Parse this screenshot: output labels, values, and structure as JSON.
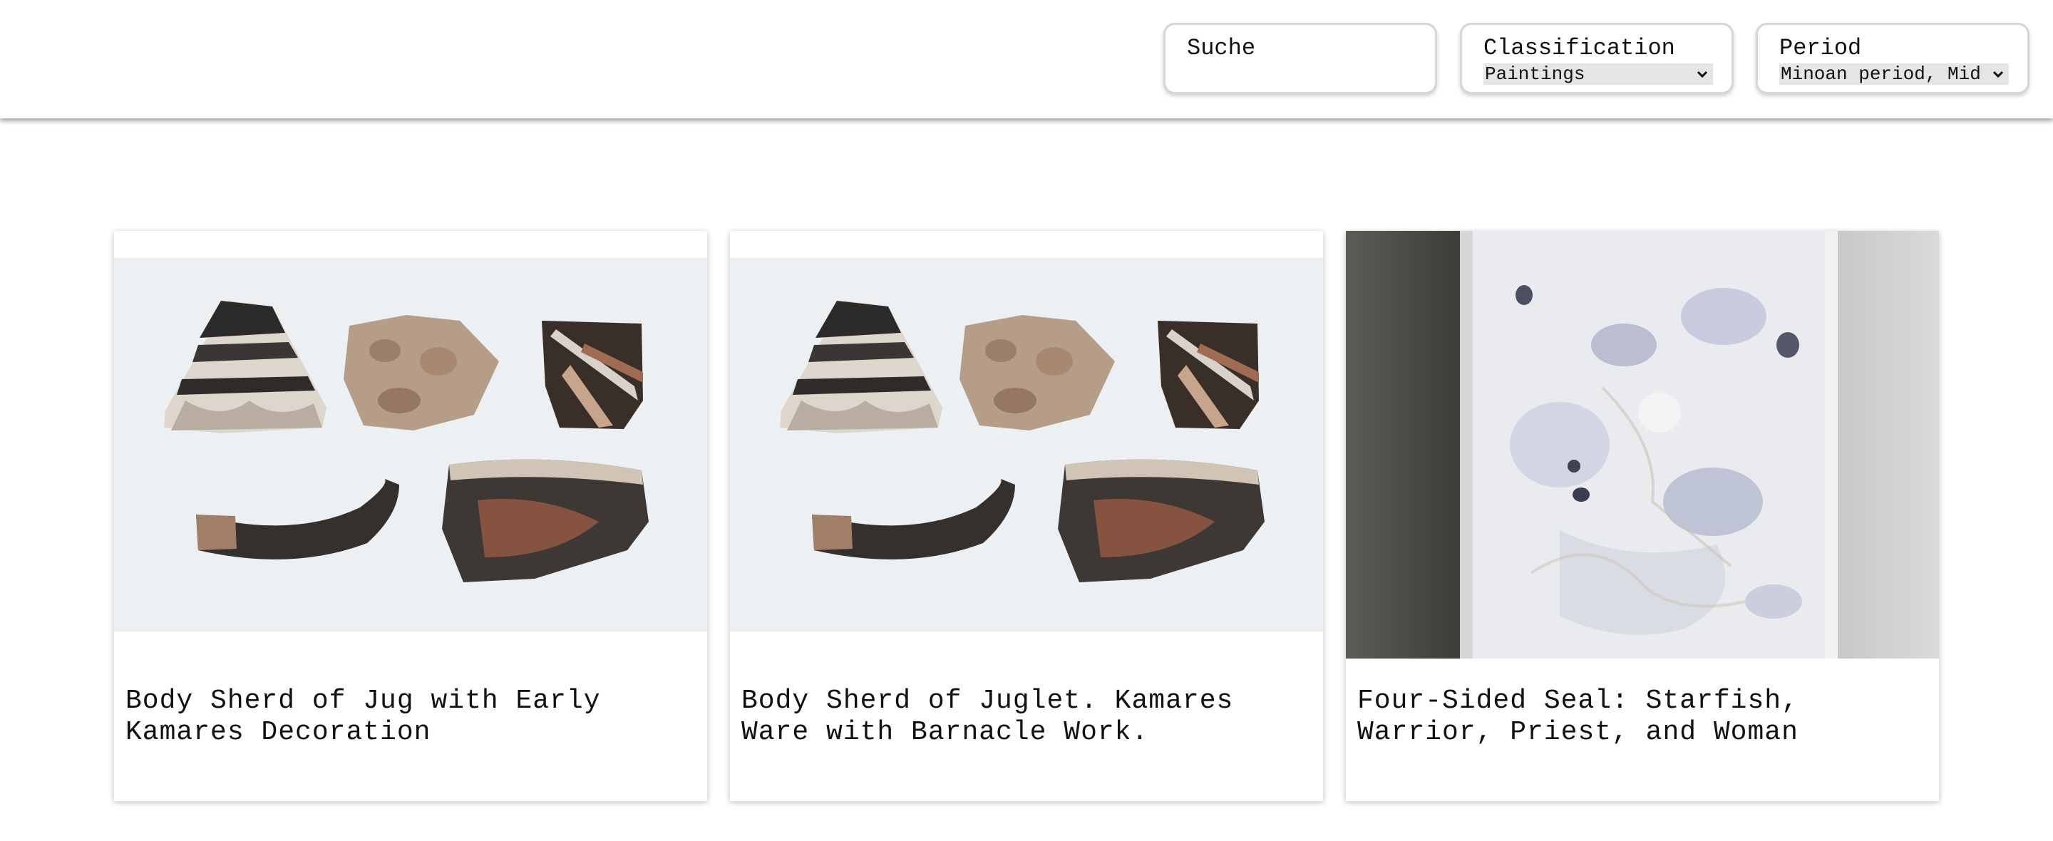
{
  "filters": {
    "search": {
      "label": "Suche",
      "value": ""
    },
    "classification": {
      "label": "Classification",
      "selected": "Paintings"
    },
    "period": {
      "label": "Period",
      "selected": "Minoan period, Mid"
    }
  },
  "cards": [
    {
      "title": "Body Sherd of Jug with Early Kamares Decoration",
      "image": "pottery-sherds-photo"
    },
    {
      "title": "Body Sherd of Juglet. Kamares Ware with Barnacle Work.",
      "image": "pottery-sherds-photo"
    },
    {
      "title": "Four-Sided Seal: Starfish, Warrior, Priest, and Woman",
      "image": "stone-seal-photo"
    }
  ]
}
